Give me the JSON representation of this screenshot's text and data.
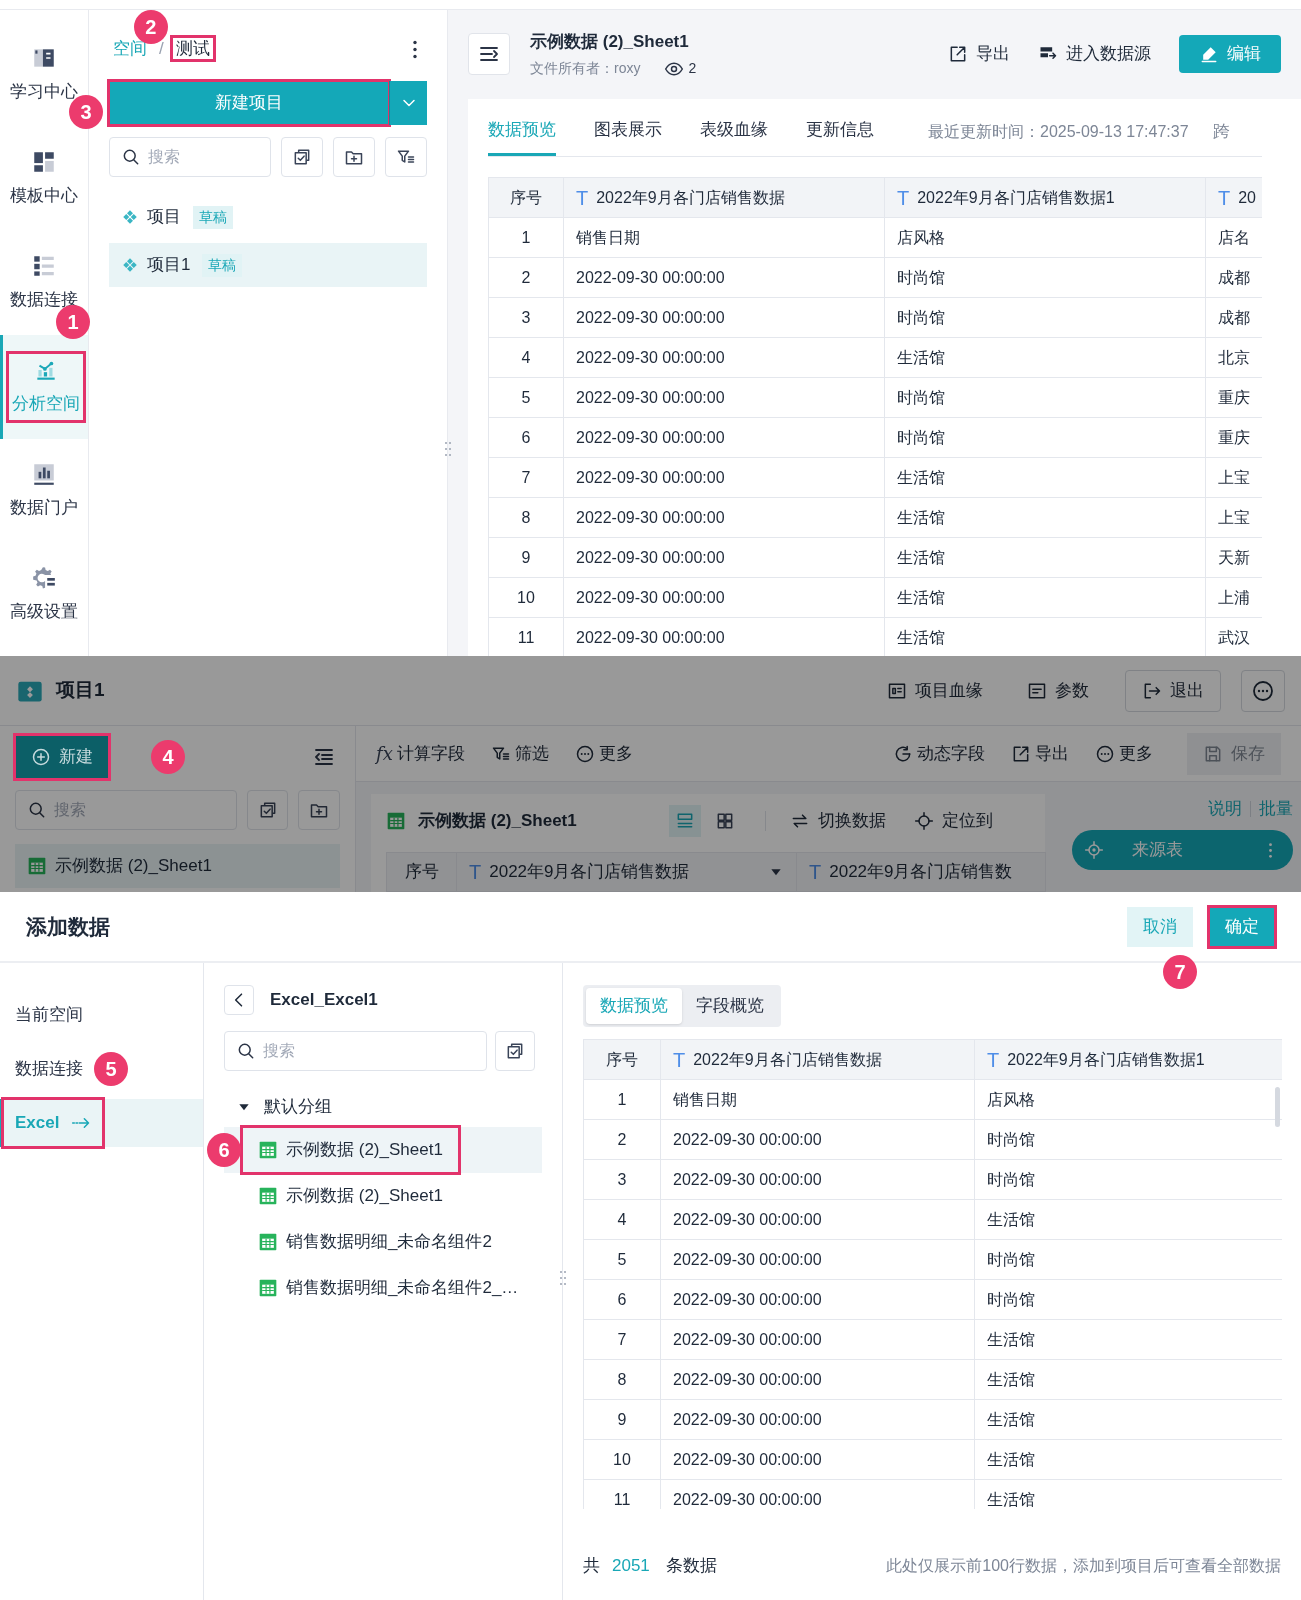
{
  "analysis_page": {
    "sidebar": {
      "items": [
        {
          "label": "学习中心",
          "selected": false,
          "highlighted": false
        },
        {
          "label": "模板中心",
          "selected": false,
          "highlighted": false
        },
        {
          "label": "数据连接",
          "selected": false,
          "highlighted": false
        },
        {
          "label": "分析空间",
          "selected": true,
          "highlighted": true,
          "callout": "1"
        },
        {
          "label": "数据门户",
          "selected": false,
          "highlighted": false
        },
        {
          "label": "高级设置",
          "selected": false,
          "highlighted": false
        }
      ]
    },
    "project_panel": {
      "breadcrumb": [
        {
          "label": "空间",
          "highlighted": false
        },
        {
          "label": "测试",
          "highlighted": true,
          "callout": "2"
        }
      ],
      "separator": "/",
      "new_button": {
        "label": "新建项目",
        "highlighted": true,
        "callout": "3"
      },
      "search": {
        "placeholder": "搜索"
      },
      "items": [
        {
          "label": "项目",
          "badge": "草稿",
          "selected": false
        },
        {
          "label": "项目1",
          "badge": "草稿",
          "selected": true
        }
      ]
    },
    "dataset": {
      "title": "示例数据 (2)_Sheet1",
      "owner": "文件所有者：roxy",
      "views": "2",
      "actions": [
        {
          "label": "导出",
          "kind": "link"
        },
        {
          "label": "进入数据源",
          "kind": "link"
        },
        {
          "label": "编辑",
          "kind": "primary"
        }
      ],
      "tabs": [
        {
          "label": "数据预览",
          "selected": true
        },
        {
          "label": "图表展示",
          "selected": false
        },
        {
          "label": "表级血缘",
          "selected": false
        },
        {
          "label": "更新信息",
          "selected": false
        }
      ],
      "updated": "最近更新时间：2025-09-13 17:47:37",
      "overflow_tab": "跨",
      "table": {
        "columns": [
          {
            "label": "序号"
          },
          {
            "label": "2022年9月各门店销售数据",
            "type": "T"
          },
          {
            "label": "2022年9月各门店销售数据1",
            "type": "T"
          },
          {
            "label": "20",
            "type": "T"
          }
        ],
        "rows": [
          [
            "1",
            "销售日期",
            "店风格",
            "店名"
          ],
          [
            "2",
            "2022-09-30 00:00:00",
            "时尚馆",
            "成都"
          ],
          [
            "3",
            "2022-09-30 00:00:00",
            "时尚馆",
            "成都"
          ],
          [
            "4",
            "2022-09-30 00:00:00",
            "生活馆",
            "北京"
          ],
          [
            "5",
            "2022-09-30 00:00:00",
            "时尚馆",
            "重庆"
          ],
          [
            "6",
            "2022-09-30 00:00:00",
            "时尚馆",
            "重庆"
          ],
          [
            "7",
            "2022-09-30 00:00:00",
            "生活馆",
            "上宝"
          ],
          [
            "8",
            "2022-09-30 00:00:00",
            "生活馆",
            "上宝"
          ],
          [
            "9",
            "2022-09-30 00:00:00",
            "生活馆",
            "天新"
          ],
          [
            "10",
            "2022-09-30 00:00:00",
            "生活馆",
            "上浦"
          ],
          [
            "11",
            "2022-09-30 00:00:00",
            "生活馆",
            "武汉"
          ]
        ]
      }
    }
  },
  "project_editor": {
    "dimmed": true,
    "title": "项目1",
    "header_actions": [
      {
        "label": "项目血缘",
        "kind": "link"
      },
      {
        "label": "参数",
        "kind": "link"
      },
      {
        "label": "退出",
        "kind": "outlined"
      }
    ],
    "new_button": {
      "label": "新建",
      "highlighted": true,
      "callout": "4"
    },
    "search": {
      "placeholder": "搜索"
    },
    "items": [
      {
        "label": "示例数据 (2)_Sheet1",
        "selected": true
      }
    ],
    "toolbar": [
      {
        "label": "计算字段",
        "icon_text": "fx"
      },
      {
        "label": "筛选"
      },
      {
        "label": "更多"
      },
      {
        "label": "动态字段"
      },
      {
        "label": "导出"
      },
      {
        "label": "更多"
      }
    ],
    "save": {
      "label": "保存",
      "disabled": true
    },
    "dataset_bar": {
      "title": "示例数据 (2)_Sheet1",
      "actions": [
        "切换数据",
        "定位到"
      ]
    },
    "side_links": [
      "说明",
      "批量"
    ],
    "source_node": {
      "label": "来源表"
    },
    "table": {
      "columns": [
        {
          "label": "序号"
        },
        {
          "label": "2022年9月各门店销售数据",
          "type": "T"
        },
        {
          "label": "2022年9月各门店销售数",
          "type": "T"
        }
      ]
    }
  },
  "add_data_dialog": {
    "title": "添加数据",
    "cancel": {
      "label": "取消"
    },
    "confirm": {
      "label": "确定",
      "highlighted": true,
      "callout": "7"
    },
    "sources": [
      {
        "label": "当前空间",
        "selected": false,
        "highlighted": false
      },
      {
        "label": "数据连接",
        "selected": false,
        "highlighted": false,
        "callout": "5"
      },
      {
        "label": "Excel",
        "selected": true,
        "highlighted": true
      }
    ],
    "browser": {
      "title": "Excel_Excel1",
      "search": {
        "placeholder": "搜索"
      },
      "group": {
        "label": "默认分组",
        "expanded": true,
        "children": [
          {
            "label": "示例数据 (2)_Sheet1",
            "selected": true,
            "highlighted": true,
            "callout": "6"
          },
          {
            "label": "示例数据 (2)_Sheet1",
            "selected": false,
            "highlighted": false
          },
          {
            "label": "销售数据明细_未命名组件2",
            "selected": false,
            "highlighted": false
          },
          {
            "label": "销售数据明细_未命名组件2_…",
            "selected": false,
            "highlighted": false
          }
        ]
      }
    },
    "preview": {
      "tabs": [
        {
          "label": "数据预览",
          "selected": true
        },
        {
          "label": "字段概览",
          "selected": false
        }
      ],
      "table": {
        "columns": [
          {
            "label": "序号"
          },
          {
            "label": "2022年9月各门店销售数据",
            "type": "T"
          },
          {
            "label": "2022年9月各门店销售数据1",
            "type": "T"
          }
        ],
        "rows": [
          [
            "1",
            "销售日期",
            "店风格"
          ],
          [
            "2",
            "2022-09-30 00:00:00",
            "时尚馆"
          ],
          [
            "3",
            "2022-09-30 00:00:00",
            "时尚馆"
          ],
          [
            "4",
            "2022-09-30 00:00:00",
            "生活馆"
          ],
          [
            "5",
            "2022-09-30 00:00:00",
            "时尚馆"
          ],
          [
            "6",
            "2022-09-30 00:00:00",
            "时尚馆"
          ],
          [
            "7",
            "2022-09-30 00:00:00",
            "生活馆"
          ],
          [
            "8",
            "2022-09-30 00:00:00",
            "生活馆"
          ],
          [
            "9",
            "2022-09-30 00:00:00",
            "生活馆"
          ],
          [
            "10",
            "2022-09-30 00:00:00",
            "生活馆"
          ],
          [
            "11",
            "2022-09-30 00:00:00",
            "生活馆"
          ]
        ]
      },
      "footer": {
        "prefix": "共",
        "count": "2051",
        "suffix": "条数据",
        "note": "此处仅展示前100行数据，添加到项目后可查看全部数据"
      }
    }
  }
}
